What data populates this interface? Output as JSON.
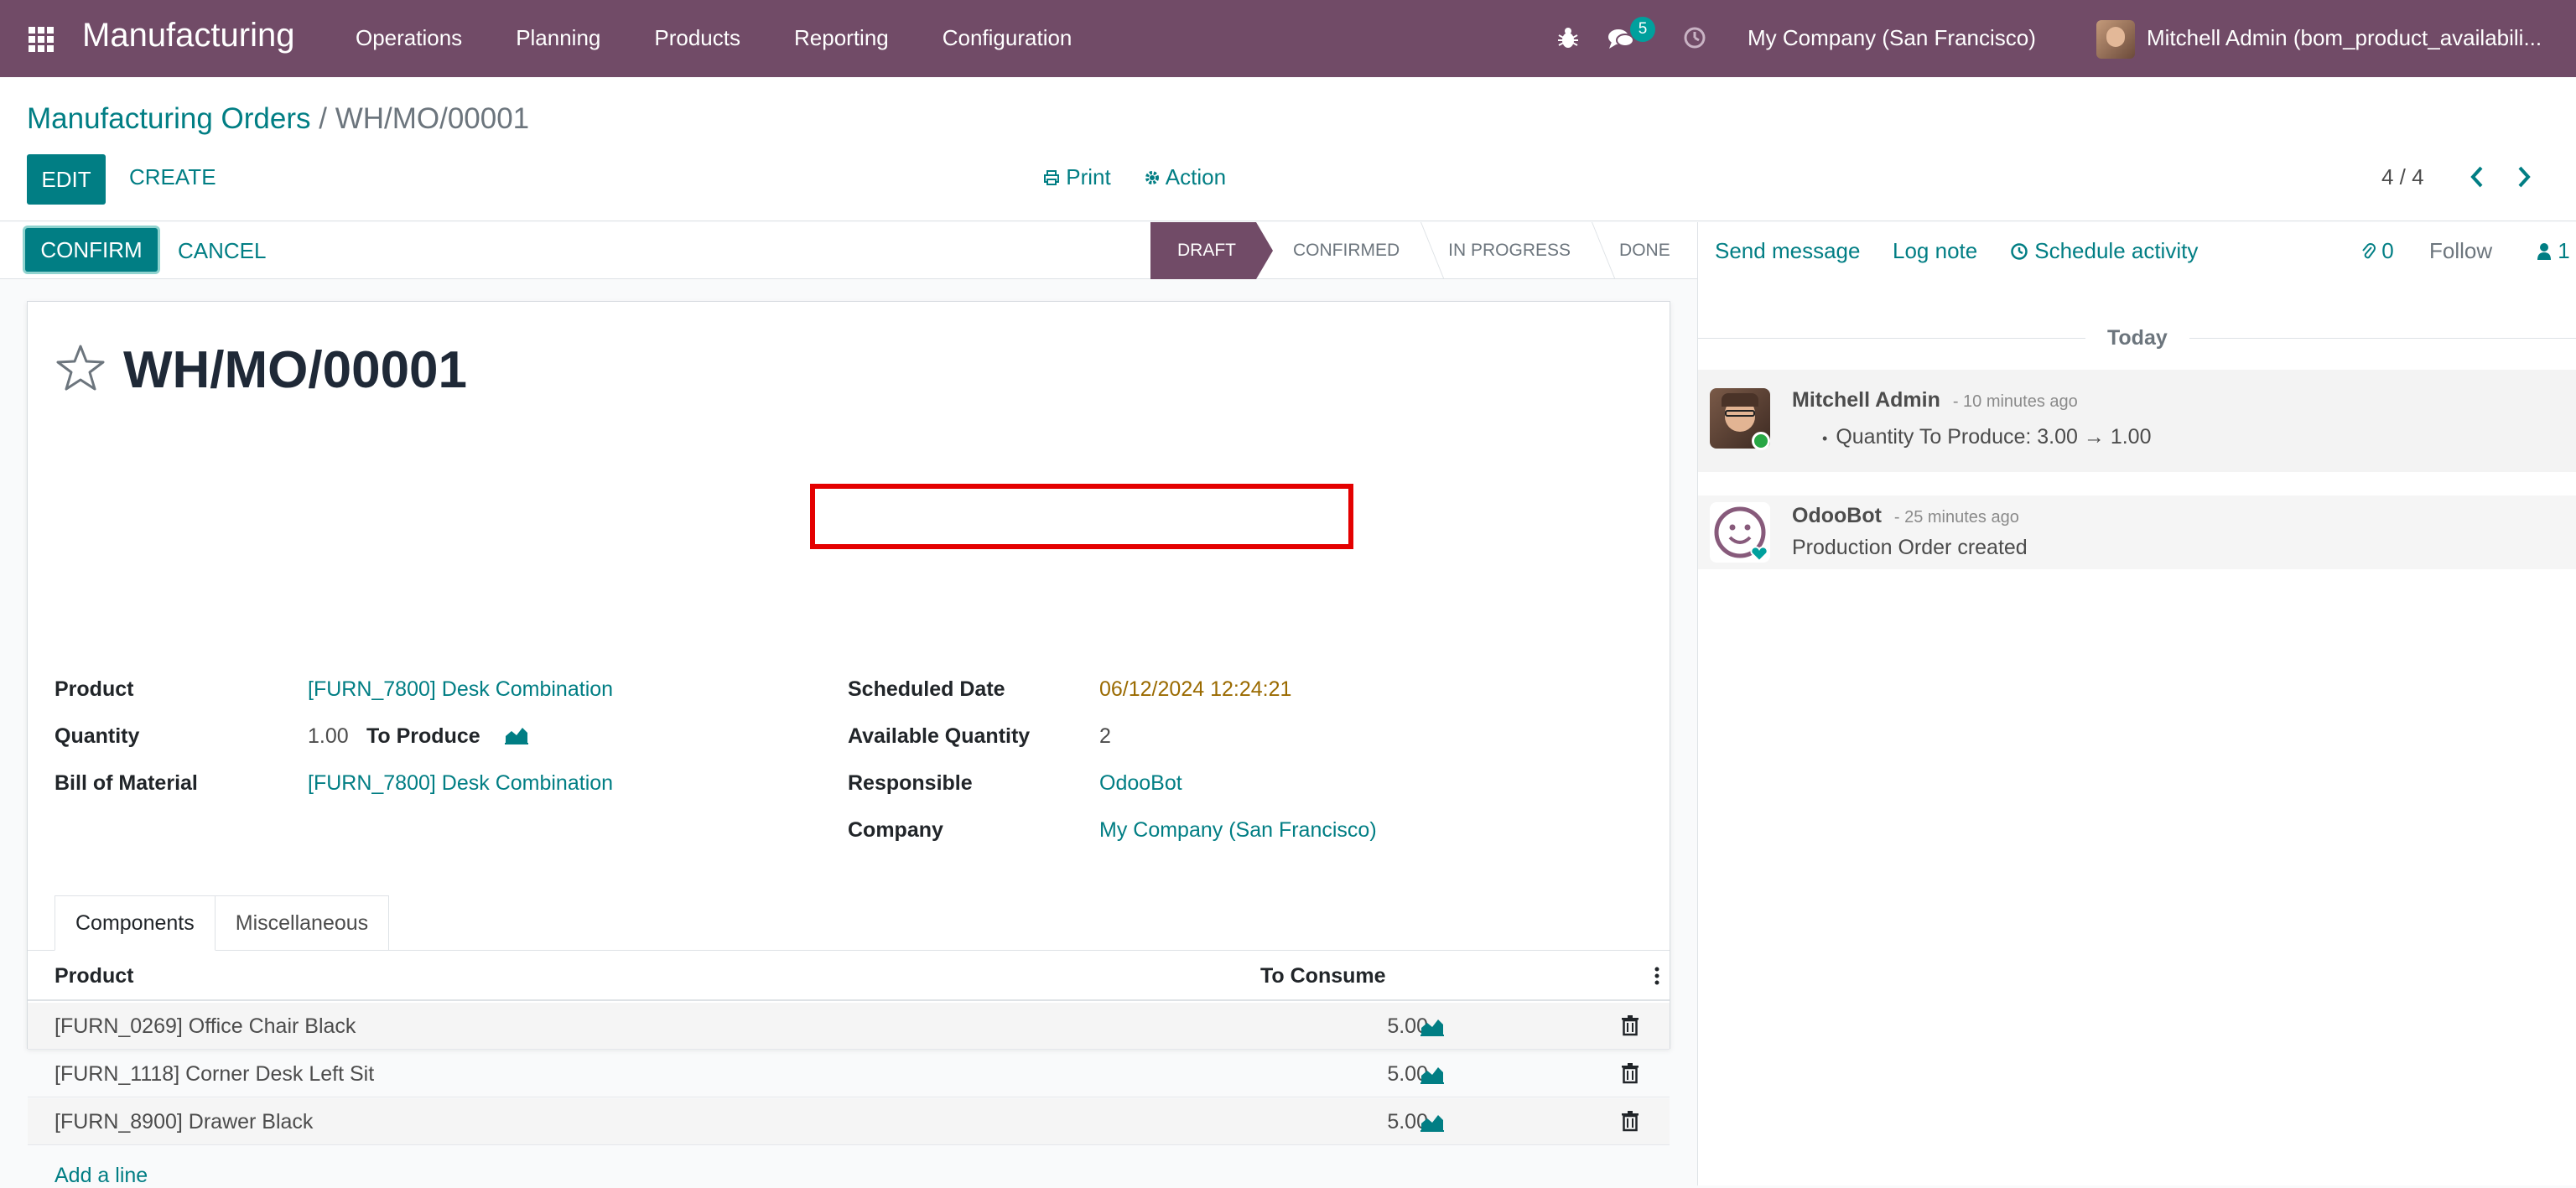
{
  "topbar": {
    "app_name": "Manufacturing",
    "menu": [
      "Operations",
      "Planning",
      "Products",
      "Reporting",
      "Configuration"
    ],
    "chat_badge": "5",
    "company": "My Company (San Francisco)",
    "user": "Mitchell Admin (bom_product_availabili..."
  },
  "breadcrumb": {
    "parent": "Manufacturing Orders",
    "separator": "/",
    "current": "WH/MO/00001"
  },
  "controls": {
    "edit": "EDIT",
    "create": "CREATE",
    "print": "Print",
    "action": "Action",
    "pager": "4 / 4"
  },
  "statusbar": {
    "confirm": "CONFIRM",
    "cancel": "CANCEL",
    "stages": [
      "DRAFT",
      "CONFIRMED",
      "IN PROGRESS",
      "DONE"
    ],
    "active_stage": "DRAFT"
  },
  "record": {
    "title": "WH/MO/00001",
    "left_fields": {
      "product_label": "Product",
      "product_value": "[FURN_7800] Desk Combination",
      "quantity_label": "Quantity",
      "quantity_value": "1.00",
      "quantity_suffix": "To Produce",
      "bom_label": "Bill of Material",
      "bom_value": "[FURN_7800] Desk Combination"
    },
    "right_fields": {
      "scheduled_label": "Scheduled Date",
      "scheduled_value": "06/12/2024 12:24:21",
      "available_label": "Available Quantity",
      "available_value": "2",
      "responsible_label": "Responsible",
      "responsible_value": "OdooBot",
      "company_label": "Company",
      "company_value": "My Company (San Francisco)"
    }
  },
  "tabs": [
    "Components",
    "Miscellaneous"
  ],
  "components_table": {
    "headers": {
      "product": "Product",
      "to_consume": "To Consume"
    },
    "rows": [
      {
        "product": "[FURN_0269] Office Chair Black",
        "to_consume": "5.00"
      },
      {
        "product": "[FURN_1118] Corner Desk Left Sit",
        "to_consume": "5.00"
      },
      {
        "product": "[FURN_8900] Drawer Black",
        "to_consume": "5.00"
      }
    ],
    "add_line": "Add a line"
  },
  "chatter": {
    "send_message": "Send message",
    "log_note": "Log note",
    "schedule_activity": "Schedule activity",
    "attachments_count": "0",
    "follow": "Follow",
    "followers_count": "1",
    "date_separator": "Today",
    "messages": [
      {
        "author": "Mitchell Admin",
        "date": "- 10 minutes ago",
        "body": "Quantity To Produce: 3.00 → 1.00"
      },
      {
        "author": "OdooBot",
        "date": "- 25 minutes ago",
        "body": "Production Order created"
      }
    ]
  },
  "colors": {
    "brand": "#714b67",
    "accent": "#017e84",
    "highlight": "#e40000"
  }
}
